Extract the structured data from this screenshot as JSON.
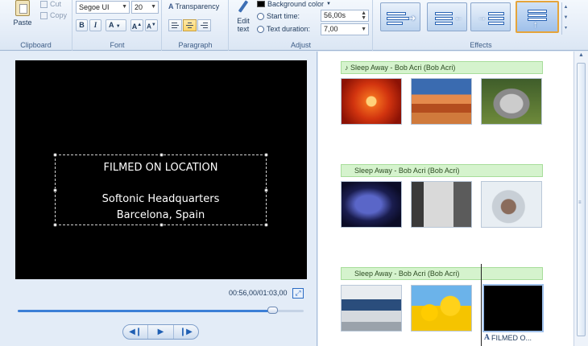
{
  "ribbon": {
    "clipboard": {
      "label": "Clipboard",
      "paste": "Paste",
      "cut": "Cut",
      "copy": "Copy"
    },
    "font": {
      "label": "Font",
      "family": "Segoe UI",
      "size": "20",
      "bold": "B",
      "italic": "I",
      "color": "A",
      "grow": "A",
      "shrink": "A"
    },
    "paragraph": {
      "label": "Paragraph",
      "transparency": "Transparency"
    },
    "adjust": {
      "label": "Adjust",
      "edit_text": "Edit text",
      "background_color": "Background color",
      "start_time_label": "Start time:",
      "start_time_value": "56,00s",
      "text_duration_label": "Text duration:",
      "text_duration_value": "7,00"
    },
    "effects": {
      "label": "Effects"
    }
  },
  "preview": {
    "caption_line1": "FILMED ON LOCATION",
    "caption_line2": "Softonic Headquarters",
    "caption_line3": "Barcelona, Spain",
    "time": "00:56,00/01:03,00",
    "progress": 0.89
  },
  "playback": {
    "prev": "◀❙",
    "play": "▶",
    "next": "❙▶"
  },
  "storyboard": {
    "music": [
      "Sleep Away - Bob Acri (Bob Acri)",
      "Sleep Away - Bob Acri (Bob Acri)",
      "Sleep Away - Bob Acri (Bob Acri)"
    ],
    "text_clip_label": "FILMED O..."
  },
  "icons": {
    "music": "♪",
    "expand": "⤢"
  }
}
